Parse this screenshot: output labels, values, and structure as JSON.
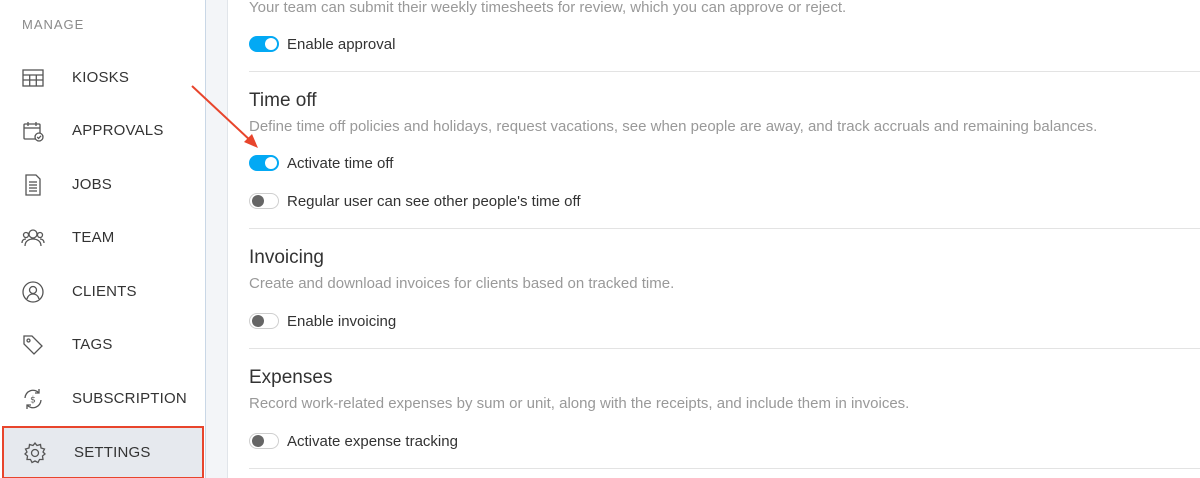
{
  "sidebar": {
    "heading": "MANAGE",
    "items": [
      {
        "label": "KIOSKS",
        "icon": "kiosk-grid-icon"
      },
      {
        "label": "APPROVALS",
        "icon": "calendar-check-icon"
      },
      {
        "label": "JOBS",
        "icon": "document-icon"
      },
      {
        "label": "TEAM",
        "icon": "team-icon"
      },
      {
        "label": "CLIENTS",
        "icon": "user-circle-icon"
      },
      {
        "label": "TAGS",
        "icon": "tag-icon"
      },
      {
        "label": "SUBSCRIPTION",
        "icon": "subscription-refresh-icon"
      },
      {
        "label": "SETTINGS",
        "icon": "gear-icon",
        "active": true
      }
    ]
  },
  "main": {
    "timesheets": {
      "desc": "Your team can submit their weekly timesheets for review, which you can approve or reject.",
      "toggles": [
        {
          "label": "Enable approval",
          "on": true
        }
      ]
    },
    "time_off": {
      "title": "Time off",
      "desc": "Define time off policies and holidays, request vacations, see when people are away, and track accruals and remaining balances.",
      "toggles": [
        {
          "label": "Activate time off",
          "on": true
        },
        {
          "label": "Regular user can see other people's time off",
          "on": false
        }
      ]
    },
    "invoicing": {
      "title": "Invoicing",
      "desc": "Create and download invoices for clients based on tracked time.",
      "toggles": [
        {
          "label": "Enable invoicing",
          "on": false
        }
      ]
    },
    "expenses": {
      "title": "Expenses",
      "desc": "Record work-related expenses by sum or unit, along with the receipts, and include them in invoices.",
      "toggles": [
        {
          "label": "Activate expense tracking",
          "on": false
        }
      ]
    }
  },
  "colors": {
    "accent": "#03a9f4",
    "highlight": "#e8452c",
    "active_bg": "#e6e9ee"
  }
}
